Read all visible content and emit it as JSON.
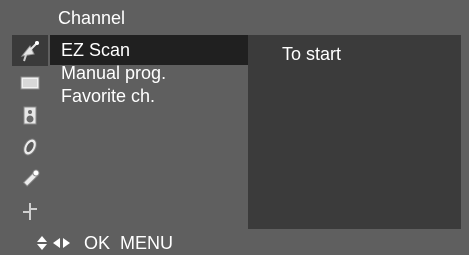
{
  "header": {
    "title": "Channel"
  },
  "sidebar": {
    "icons": [
      "satellite-dish-icon",
      "picture-screen-icon",
      "speaker-icon",
      "clock-icon",
      "wrench-icon",
      "option-icon"
    ],
    "active_index": 0
  },
  "menu": {
    "items": [
      {
        "label": "EZ Scan",
        "selected": true
      },
      {
        "label": "Manual prog.",
        "selected": false
      },
      {
        "label": "Favorite ch.",
        "selected": false
      }
    ]
  },
  "detail": {
    "text": "To start"
  },
  "footer": {
    "hint": "OK  MENU"
  },
  "colors": {
    "panel": "#5f5f5f",
    "selected_row": "#202020",
    "detail_panel": "#3b3b3b",
    "text": "#ffffff"
  }
}
